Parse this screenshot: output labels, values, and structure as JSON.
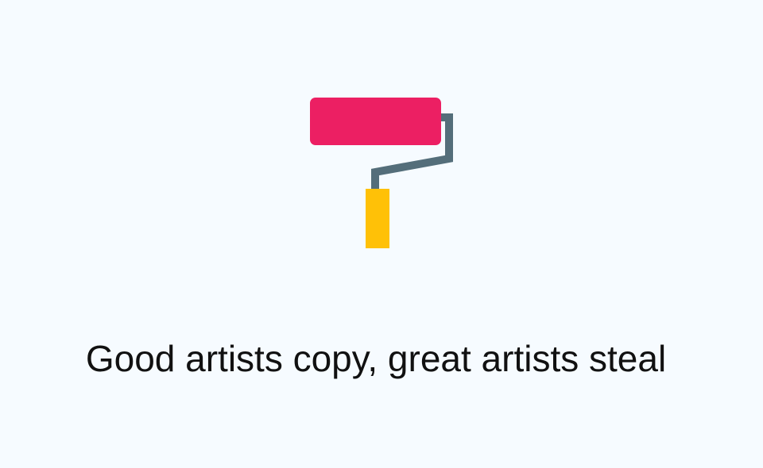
{
  "page": {
    "background": "#f6fbff"
  },
  "illustration": {
    "icon": "paint-roller-icon",
    "colors": {
      "roller": "#ec1f63",
      "handle_bar": "#546e7a",
      "grip": "#ffc107"
    }
  },
  "quote": {
    "text": "Good artists copy, great artists steal",
    "color": "#111111"
  }
}
